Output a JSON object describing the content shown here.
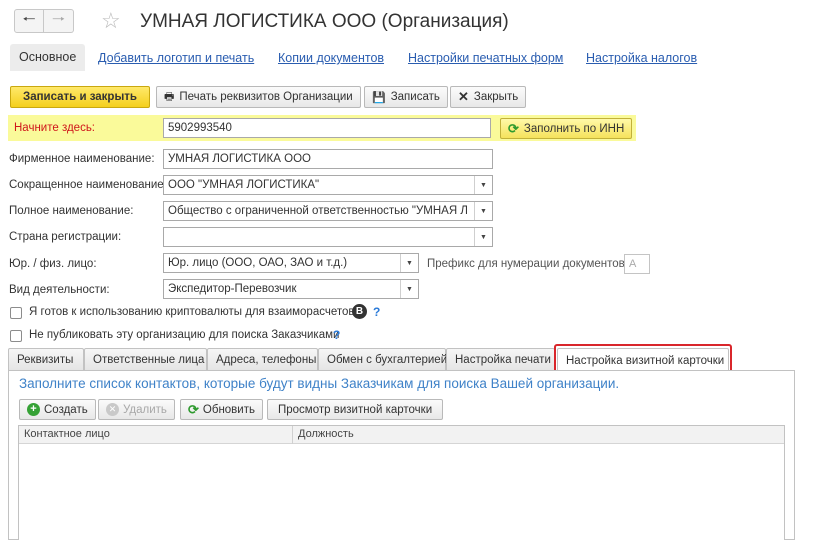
{
  "header": {
    "title": "УМНАЯ ЛОГИСТИКА ООО (Организация)",
    "back_icon": "arrow-left-icon",
    "forward_icon": "arrow-right-icon",
    "favorite_icon": "star-icon"
  },
  "nav": {
    "main": "Основное",
    "links": [
      "Добавить логотип и печать",
      "Копии документов",
      "Настройки печатных форм",
      "Настройка налогов"
    ]
  },
  "toolbar": {
    "save_close": "Записать и закрыть",
    "print_details": "Печать реквизитов Организации",
    "save": "Записать",
    "close": "Закрыть"
  },
  "search": {
    "label": "Начните здесь:",
    "value": "5902993540",
    "fill_button": "Заполнить по ИНН"
  },
  "form": {
    "brand_name_label": "Фирменное наименование:",
    "brand_name": "УМНАЯ ЛОГИСТИКА ООО",
    "short_name_label": "Сокращенное наименование:",
    "short_name": "ООО \"УМНАЯ ЛОГИСТИКА\"",
    "full_name_label": "Полное наименование:",
    "full_name": "Общество с ограниченной ответственностью \"УМНАЯ ЛОГИ",
    "country_label": "Страна регистрации:",
    "country": "",
    "entity_label": "Юр. / физ. лицо:",
    "entity": "Юр. лицо (ООО, ОАО, ЗАО и т.д.)",
    "prefix_label": "Префикс для нумерации документов :",
    "prefix": "A",
    "activity_label": "Вид деятельности:",
    "activity": "Экспедитор-Перевозчик",
    "crypto_label": "Я готов к использованию криптовалюты для взаиморасчетов",
    "crypto_icon": "B",
    "hide_label": "Не публиковать эту организацию для поиска Заказчиками",
    "help": "?"
  },
  "tabs": [
    "Реквизиты",
    "Ответственные лица",
    "Адреса, телефоны",
    "Обмен с бухгалтерией",
    "Настройка печати",
    "Настройка визитной карточки"
  ],
  "active_tab": 5,
  "panel": {
    "hint": "Заполните список контактов, которые будут видны Заказчикам для поиска Вашей организации.",
    "create": "Создать",
    "delete": "Удалить",
    "refresh": "Обновить",
    "preview": "Просмотр визитной карточки",
    "columns": [
      "Контактное лицо",
      "Должность"
    ]
  },
  "colors": {
    "accent_yellow": "#f4cf1c",
    "highlight": "#fafa9a",
    "label_red": "#d0161b",
    "link_blue": "#2a5db0",
    "tab_highlight": "#d9262b"
  }
}
